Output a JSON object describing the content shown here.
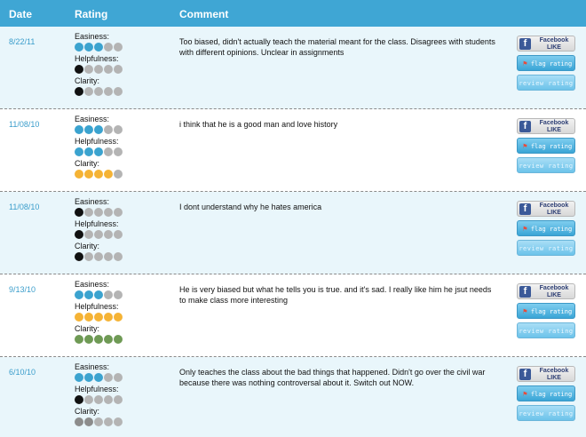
{
  "header": {
    "date": "Date",
    "rating": "Rating",
    "comment": "Comment"
  },
  "labels": {
    "easiness": "Easiness:",
    "helpfulness": "Helpfulness:",
    "clarity": "Clarity:"
  },
  "buttons": {
    "facebook_top": "Facebook",
    "facebook_bottom": "LIKE",
    "facebook_icon": "f",
    "flag": "flag rating",
    "review": "review rating"
  },
  "colors": {
    "header_bg": "#3fa6d4",
    "blue": "#3ba3cf",
    "black": "#111111",
    "orange": "#f5b335",
    "green": "#6f9a55",
    "darkgray": "#8c8c8c",
    "empty": "#b4b4b4"
  },
  "icons": {
    "facebook": "facebook-icon",
    "flag": "flag-icon"
  },
  "ratings": [
    {
      "date": "8/22/11",
      "comment": "Too biased, didn't actually teach the material meant for the class. Disagrees with students with different opinions. Unclear in assignments",
      "easiness": {
        "filled": 3,
        "color": "#3ba3cf"
      },
      "helpfulness": {
        "filled": 1,
        "color": "#111111"
      },
      "clarity": {
        "filled": 1,
        "color": "#111111"
      }
    },
    {
      "date": "11/08/10",
      "comment": "i think that he is a good man and love history",
      "easiness": {
        "filled": 3,
        "color": "#3ba3cf"
      },
      "helpfulness": {
        "filled": 3,
        "color": "#3ba3cf"
      },
      "clarity": {
        "filled": 4,
        "color": "#f5b335"
      }
    },
    {
      "date": "11/08/10",
      "comment": "I dont understand why he hates america",
      "easiness": {
        "filled": 1,
        "color": "#111111"
      },
      "helpfulness": {
        "filled": 1,
        "color": "#111111"
      },
      "clarity": {
        "filled": 1,
        "color": "#111111"
      }
    },
    {
      "date": "9/13/10",
      "comment": "He is very biased but what he tells you is true. and it's sad. I really like him he jsut needs to make class more interesting",
      "easiness": {
        "filled": 3,
        "color": "#3ba3cf"
      },
      "helpfulness": {
        "filled": 5,
        "color": "#f5b335"
      },
      "clarity": {
        "filled": 5,
        "color": "#6f9a55"
      }
    },
    {
      "date": "6/10/10",
      "comment": "Only teaches the class about the bad things that happened. Didn't go over the civil war because there was nothing controversal about it. Switch out NOW.",
      "easiness": {
        "filled": 3,
        "color": "#3ba3cf"
      },
      "helpfulness": {
        "filled": 1,
        "color": "#111111"
      },
      "clarity": {
        "filled": 2,
        "color": "#8c8c8c"
      }
    }
  ]
}
